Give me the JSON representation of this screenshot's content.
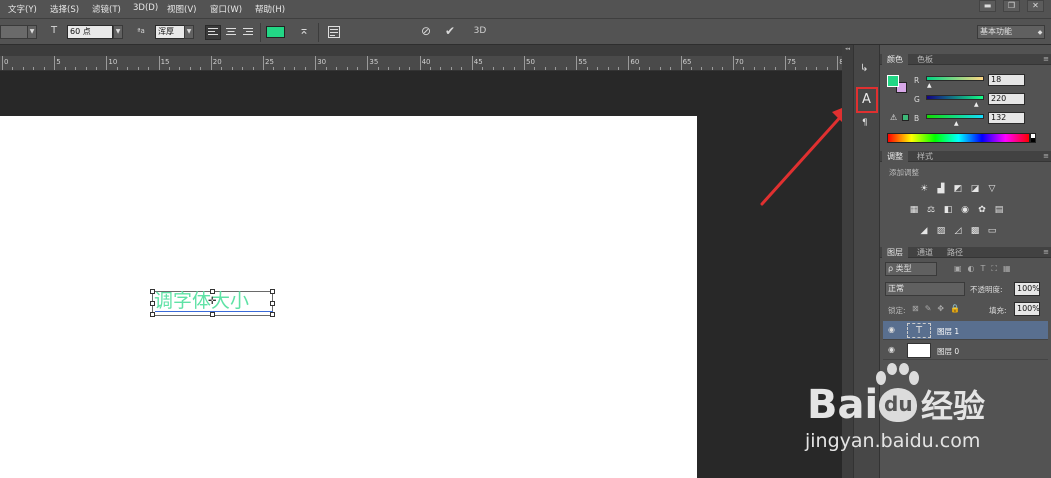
{
  "menubar": {
    "items": [
      "文字(Y)",
      "选择(S)",
      "滤镜(T)",
      "3D(D)",
      "视图(V)",
      "窗口(W)",
      "帮助(H)"
    ],
    "window_buttons": [
      "▬",
      "❐",
      "✕"
    ]
  },
  "options": {
    "font_size": "60 点",
    "antialias": "浑厚",
    "text_color": "#22d685",
    "workspace": "基本功能",
    "mode_3d": "3D"
  },
  "ruler": {
    "labels": [
      "0",
      "5",
      "10",
      "15",
      "20",
      "25",
      "30",
      "35",
      "40",
      "45",
      "50",
      "55",
      "60",
      "65",
      "70",
      "75",
      "80"
    ]
  },
  "canvas": {
    "text_layer_content": "调字体大小",
    "text_color": "#5fe2a6"
  },
  "annotation": {
    "color": "#e03030"
  },
  "color_panel": {
    "tabs": [
      "颜色",
      "色板"
    ],
    "foreground": "#22d685",
    "background": "#d8a8e8",
    "r_label": "R",
    "g_label": "G",
    "b_label": "B",
    "r": "18",
    "g": "220",
    "b": "132"
  },
  "adjust_panel": {
    "tabs": [
      "调整",
      "样式"
    ],
    "heading": "添加调整"
  },
  "layers_panel": {
    "tabs": [
      "图层",
      "通道",
      "路径"
    ],
    "filter_label": "ρ 类型",
    "blend_mode": "正常",
    "opacity_label": "不透明度:",
    "opacity": "100%",
    "lock_label": "锁定:",
    "fill_label": "填充:",
    "fill": "100%",
    "layers": [
      {
        "name": "图层 1",
        "type": "text",
        "thumb": "T"
      },
      {
        "name": "图层 0",
        "type": "image",
        "thumb": ""
      }
    ]
  },
  "watermark": {
    "brand": "Bai",
    "brand_paw": "du",
    "brand_cn": "经验",
    "url": "jingyan.baidu.com"
  }
}
